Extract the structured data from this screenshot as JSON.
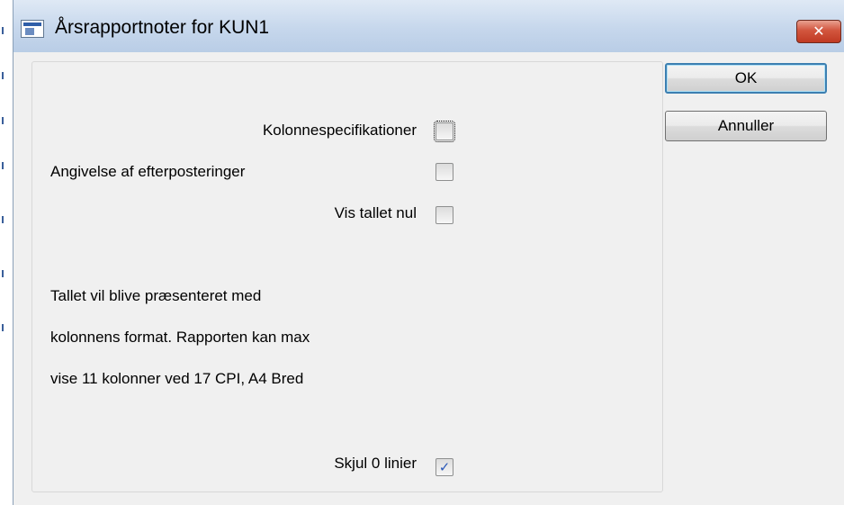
{
  "window": {
    "title": "Årsrapportnoter for KUN1",
    "icon": "app-window-icon",
    "close_glyph": "✕"
  },
  "buttons": {
    "ok_label": "OK",
    "cancel_label": "Annuller"
  },
  "options": {
    "kolonnespec_label": "Kolonnespecifikationer",
    "kolonnespec_checked": false,
    "efterposteringer_label": "Angivelse af efterposteringer",
    "efterposteringer_checked": false,
    "vis_nul_label": "Vis tallet nul",
    "vis_nul_checked": false,
    "skjul_linier_label": "Skjul 0 linier",
    "skjul_linier_checked": true
  },
  "info": {
    "line1": "Tallet vil blive præsenteret med",
    "line2": "kolonnens format. Rapporten kan max",
    "line3": "vise 11 kolonner ved 17 CPI, A4 Bred"
  },
  "colors": {
    "titlebar": "#c6d7ec",
    "close_button": "#c03a22",
    "dialog_bg": "#f0f0f0",
    "check_mark": "#2a58b8"
  }
}
